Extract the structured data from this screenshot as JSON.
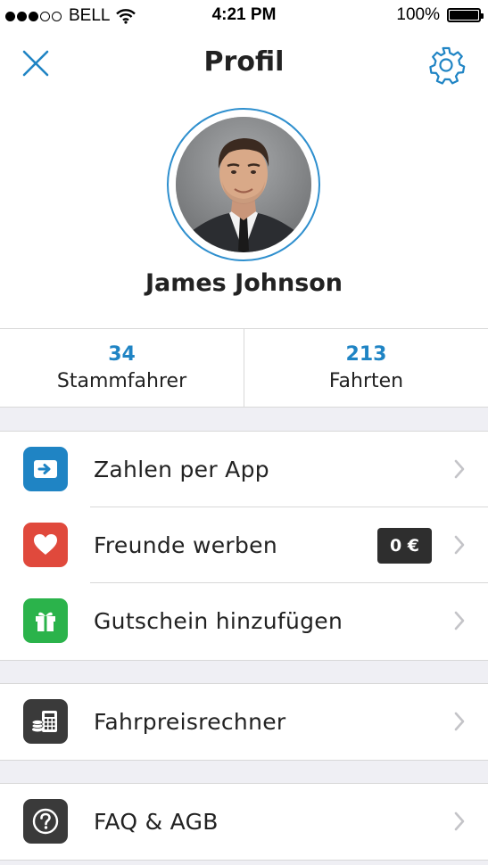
{
  "status_bar": {
    "carrier": "BELL",
    "time": "4:21 PM",
    "battery": "100%"
  },
  "header": {
    "title": "Profil"
  },
  "profile": {
    "name": "James Johnson"
  },
  "stats": [
    {
      "value": "34",
      "label": "Stammfahrer"
    },
    {
      "value": "213",
      "label": "Fahrten"
    }
  ],
  "menu": {
    "payment": {
      "label": "Zahlen per App",
      "icon": "pay-arrow-icon",
      "color": "#1f84c4"
    },
    "referral": {
      "label": "Freunde werben",
      "icon": "heart-icon",
      "color": "#e0493c",
      "badge": "0 €"
    },
    "voucher": {
      "label": "Gutschein hinzufügen",
      "icon": "gift-icon",
      "color": "#2bb34b"
    },
    "calculator": {
      "label": "Fahrpreisrechner",
      "icon": "calculator-icon",
      "color": "#3a3a3a"
    },
    "faq": {
      "label": "FAQ & AGB",
      "icon": "question-icon",
      "color": "#3a3a3a"
    }
  },
  "colors": {
    "accent": "#1f84c4",
    "divider": "#d8d8d8",
    "section_gap": "#efeff4"
  }
}
